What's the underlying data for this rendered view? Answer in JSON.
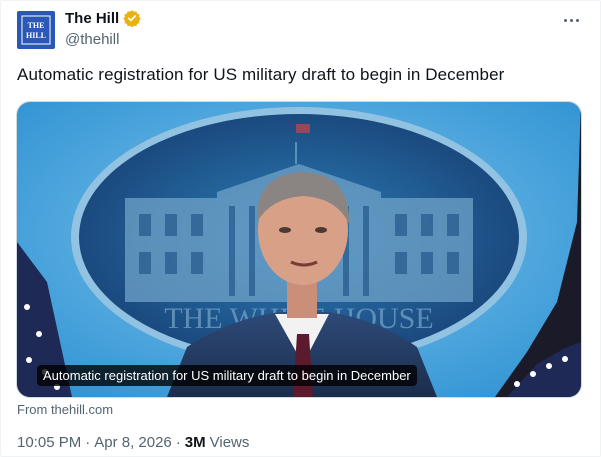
{
  "author": {
    "name": "The Hill",
    "handle": "@thehill",
    "avatar_logo_text": "THE HILL",
    "verified_icon": "verified-badge-icon"
  },
  "tweet": {
    "text": "Automatic registration for US military draft to begin in December"
  },
  "card": {
    "caption": "Automatic registration for US military draft to begin in December",
    "source": "From thehill.com",
    "image_lettering": "THE WHITE HOUSE"
  },
  "meta": {
    "time": "10:05 PM",
    "separator1": "·",
    "date": "Apr 8, 2026",
    "separator2": "·",
    "views_count": "3M",
    "views_label": "Views"
  },
  "colors": {
    "verified_badge": "#e8b213",
    "avatar_bg": "#2a58b4",
    "text_primary": "#0f1419",
    "text_secondary": "#536471"
  },
  "icons": {
    "more": "more-icon"
  }
}
